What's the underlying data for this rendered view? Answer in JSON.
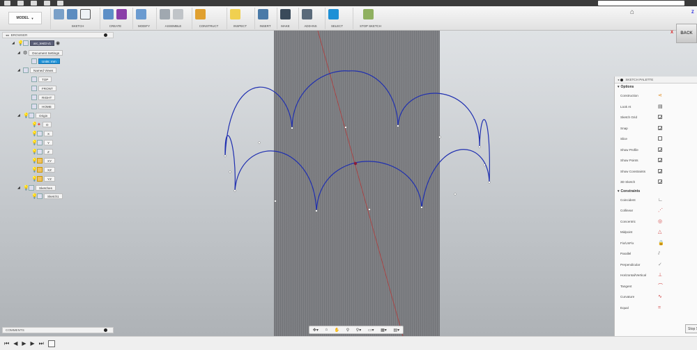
{
  "toolbar": {
    "model_label": "MODEL",
    "groups": [
      "SKETCH",
      "CREATE",
      "MODIFY",
      "ASSEMBLE",
      "CONSTRUCT",
      "INSPECT",
      "INSERT",
      "MAKE",
      "ADD-INS",
      "SELECT",
      "STOP SKETCH"
    ]
  },
  "viewcube": {
    "face": "BACK",
    "x": "X",
    "z": "Z"
  },
  "browser": {
    "title": "BROWSER",
    "root": "arc_test3 v1",
    "document_settings": "Document Settings",
    "units": "Units: mm",
    "named_views": "Named Views",
    "views": [
      "TOP",
      "FRONT",
      "RIGHT",
      "HOME"
    ],
    "origin": "Origin",
    "origin_items": [
      "O",
      "X",
      "Y",
      "Z",
      "XY",
      "XZ",
      "YZ"
    ],
    "sketches": "Sketches",
    "sketch1": "Sketch1"
  },
  "comments": {
    "title": "COMMENTS"
  },
  "palette": {
    "title": "SKETCH PALETTE",
    "options_header": "Options",
    "options": [
      {
        "label": "Construction",
        "icon": "construction-icon"
      },
      {
        "label": "Look At",
        "icon": "look-at-icon"
      },
      {
        "label": "Sketch Grid",
        "checked": true
      },
      {
        "label": "Snap",
        "checked": true
      },
      {
        "label": "Slice",
        "checked": false
      },
      {
        "label": "Show Profile",
        "checked": true
      },
      {
        "label": "Show Points",
        "checked": true
      },
      {
        "label": "Show Constraints",
        "checked": true
      },
      {
        "label": "3D Sketch",
        "checked": true
      }
    ],
    "constraints_header": "Constraints",
    "constraints": [
      "Coincident",
      "Collinear",
      "Concentric",
      "Midpoint",
      "Fix/UnFix",
      "Parallel",
      "Perpendicular",
      "Horizontal/Vertical",
      "Tangent",
      "Curvature",
      "Equal"
    ]
  },
  "stop_sketch": "Stop Sket",
  "colors": {
    "arc": "#1f2fb0",
    "accent": "#1e90d6",
    "axis_red": "#b23a3a"
  }
}
